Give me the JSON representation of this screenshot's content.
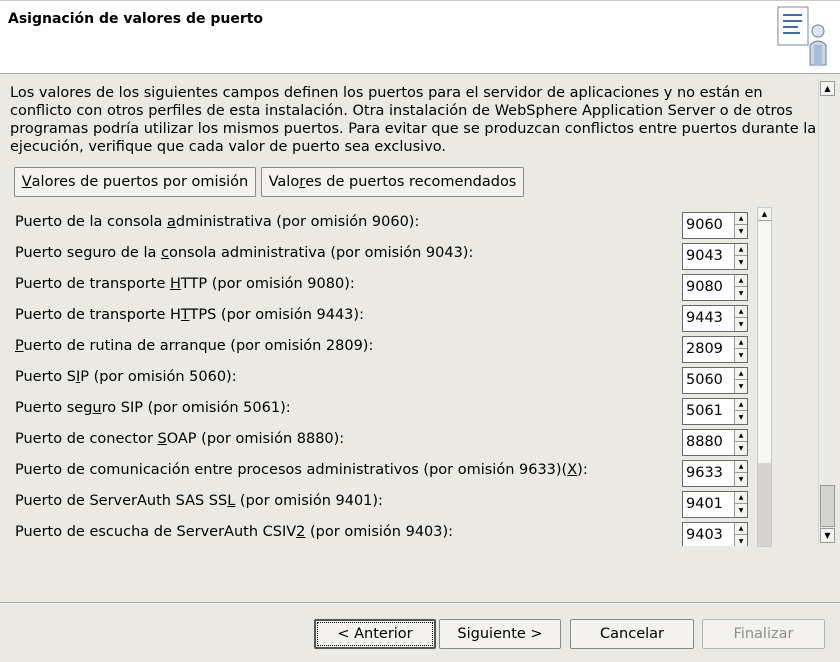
{
  "header": {
    "title": "Asignación de valores de puerto",
    "icon": "document-person-icon"
  },
  "description": "Los valores de los siguientes campos definen los puertos para el servidor de aplicaciones y no están en conflicto con otros perfiles de esta instalación. Otra instalación de WebSphere Application Server o de otros programas podría utilizar los mismos puertos. Para evitar que se produzcan conflictos entre puertos durante la ejecución, verifique que cada valor de puerto sea exclusivo.",
  "buttons": {
    "default_ports": {
      "pre": "",
      "mnemonic": "V",
      "post": "alores de puertos por omisión"
    },
    "recommended_ports": {
      "pre": "Valo",
      "mnemonic": "r",
      "post": "es de puertos recomendados"
    }
  },
  "ports": [
    {
      "pre": "Puerto de la consola ",
      "mnemonic": "a",
      "post": "dministrativa (por omisión 9060):",
      "value": "9060"
    },
    {
      "pre": "Puerto seguro de la ",
      "mnemonic": "c",
      "post": "onsola administrativa (por omisión 9043):",
      "value": "9043"
    },
    {
      "pre": "Puerto de transporte ",
      "mnemonic": "H",
      "post": "TTP (por omisión 9080):",
      "value": "9080"
    },
    {
      "pre": "Puerto de transporte H",
      "mnemonic": "T",
      "post": "TPS (por omisión 9443):",
      "value": "9443"
    },
    {
      "pre": "",
      "mnemonic": "P",
      "post": "uerto de rutina de arranque (por omisión 2809):",
      "value": "2809"
    },
    {
      "pre": "Puerto S",
      "mnemonic": "I",
      "post": "P (por omisión 5060):",
      "value": "5060"
    },
    {
      "pre": "Puerto seg",
      "mnemonic": "u",
      "post": "ro SIP (por omisión 5061):",
      "value": "5061"
    },
    {
      "pre": "Puerto de conector ",
      "mnemonic": "S",
      "post": "OAP (por omisión 8880):",
      "value": "8880"
    },
    {
      "pre": "Puerto de comunicación entre procesos administrativos (por omisión 9633)(",
      "mnemonic": "X",
      "post": "):",
      "value": "9633"
    },
    {
      "pre": "Puerto de ServerAuth SAS SS",
      "mnemonic": "L",
      "post": " (por omisión 9401):",
      "value": "9401"
    },
    {
      "pre": "Puerto de escucha de ServerAuth CSIV",
      "mnemonic": "2",
      "post": " (por omisión 9403):",
      "value": "9403"
    }
  ],
  "footer": {
    "back_label": "< Anterior",
    "next_label": "Siguiente >",
    "cancel_label": "Cancelar",
    "finish_label": "Finalizar"
  },
  "colors": {
    "background": "#eae9e4",
    "header_bg": "#ffffff",
    "disabled_text": "#8e8e8e"
  }
}
